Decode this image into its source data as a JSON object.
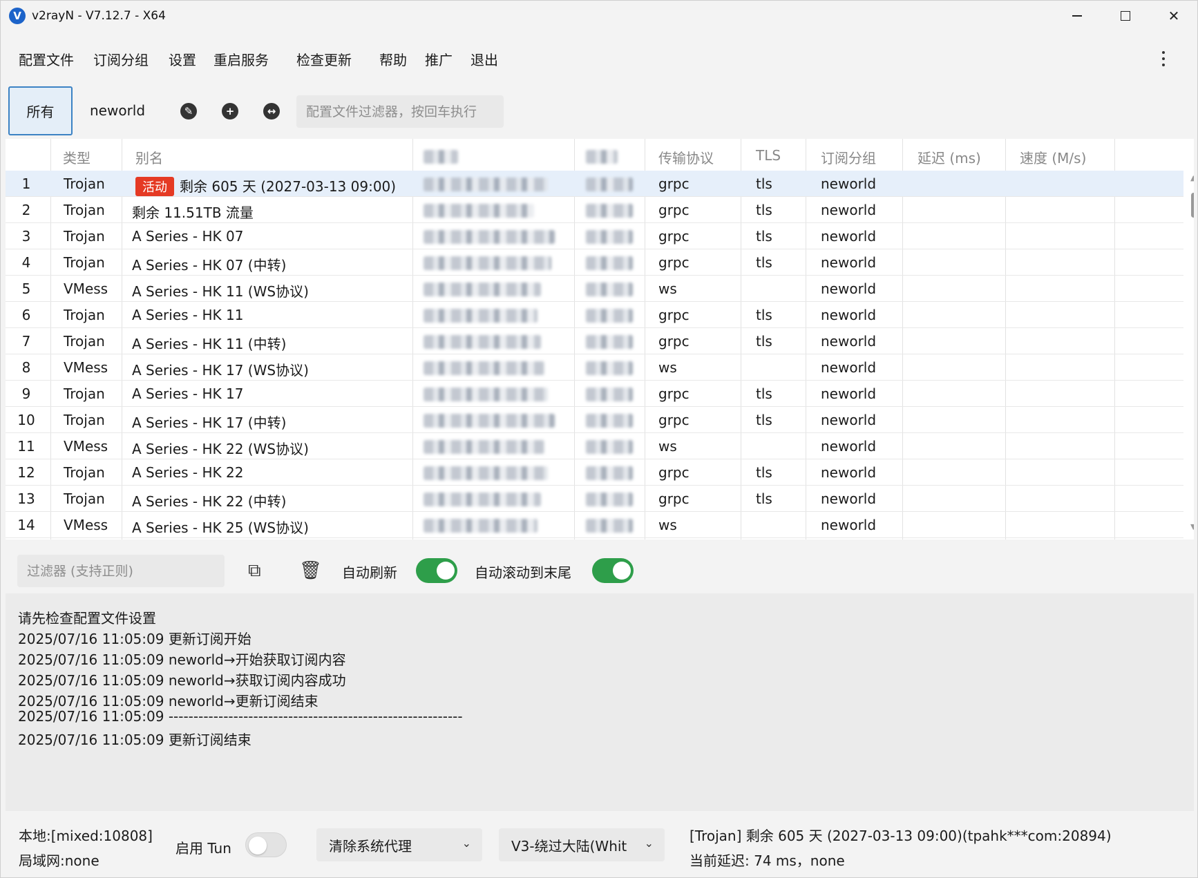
{
  "window": {
    "title": "v2rayN - V7.12.7 - X64",
    "logo": "V"
  },
  "menu": [
    "配置文件",
    "订阅分组",
    "设置",
    "重启服务",
    "检查更新",
    "帮助",
    "推广",
    "退出"
  ],
  "tabs": {
    "all": "所有",
    "neworld": "neworld"
  },
  "toolbar": {
    "filter_placeholder": "配置文件过滤器，按回车执行"
  },
  "table": {
    "headers": [
      "类型",
      "别名",
      "传输协议",
      "TLS",
      "订阅分组",
      "延迟 (ms)",
      "速度 (M/s)"
    ],
    "active_badge": "活动",
    "rows": [
      {
        "n": "1",
        "type": "Trojan",
        "alias": "剩余 605 天 (2027-03-13 09:00)",
        "net": "grpc",
        "tls": "tls",
        "group": "neworld"
      },
      {
        "n": "2",
        "type": "Trojan",
        "alias": "剩余 11.51TB 流量",
        "net": "grpc",
        "tls": "tls",
        "group": "neworld"
      },
      {
        "n": "3",
        "type": "Trojan",
        "alias": "A Series - HK 07",
        "net": "grpc",
        "tls": "tls",
        "group": "neworld"
      },
      {
        "n": "4",
        "type": "Trojan",
        "alias": "A Series - HK 07 (中转)",
        "net": "grpc",
        "tls": "tls",
        "group": "neworld"
      },
      {
        "n": "5",
        "type": "VMess",
        "alias": "A Series - HK 11 (WS协议)",
        "net": "ws",
        "tls": "",
        "group": "neworld"
      },
      {
        "n": "6",
        "type": "Trojan",
        "alias": "A Series - HK 11",
        "net": "grpc",
        "tls": "tls",
        "group": "neworld"
      },
      {
        "n": "7",
        "type": "Trojan",
        "alias": "A Series - HK 11 (中转)",
        "net": "grpc",
        "tls": "tls",
        "group": "neworld"
      },
      {
        "n": "8",
        "type": "VMess",
        "alias": "A Series - HK 17 (WS协议)",
        "net": "ws",
        "tls": "",
        "group": "neworld"
      },
      {
        "n": "9",
        "type": "Trojan",
        "alias": "A Series - HK 17",
        "net": "grpc",
        "tls": "tls",
        "group": "neworld"
      },
      {
        "n": "10",
        "type": "Trojan",
        "alias": "A Series - HK 17 (中转)",
        "net": "grpc",
        "tls": "tls",
        "group": "neworld"
      },
      {
        "n": "11",
        "type": "VMess",
        "alias": "A Series - HK 22 (WS协议)",
        "net": "ws",
        "tls": "",
        "group": "neworld"
      },
      {
        "n": "12",
        "type": "Trojan",
        "alias": "A Series - HK 22",
        "net": "grpc",
        "tls": "tls",
        "group": "neworld"
      },
      {
        "n": "13",
        "type": "Trojan",
        "alias": "A Series - HK 22 (中转)",
        "net": "grpc",
        "tls": "tls",
        "group": "neworld"
      },
      {
        "n": "14",
        "type": "VMess",
        "alias": "A Series - HK 25 (WS协议)",
        "net": "ws",
        "tls": "",
        "group": "neworld"
      }
    ]
  },
  "log_toolbar": {
    "filter_placeholder": "过滤器 (支持正则)",
    "auto_refresh": "自动刷新",
    "auto_scroll": "自动滚动到末尾",
    "auto_refresh_on": true,
    "auto_scroll_on": true
  },
  "log": [
    "请先检查配置文件设置",
    "2025/07/16 11:05:09 更新订阅开始",
    "2025/07/16 11:05:09 neworld→开始获取订阅内容",
    "2025/07/16 11:05:09 neworld→获取订阅内容成功",
    "2025/07/16 11:05:09 neworld→更新订阅结束",
    "2025/07/16 11:05:09 -----------------------------------------------------------",
    "2025/07/16 11:05:09 更新订阅结束"
  ],
  "status": {
    "local": "本地:[mixed:10808]",
    "lan": "局域网:none",
    "tun_label": "启用 Tun",
    "tun_on": false,
    "proxy_mode": "清除系统代理",
    "routing": "V3-绕过大陆(Whit",
    "current_server": "[Trojan] 剩余 605 天 (2027-03-13 09:00)(tpahk***com:20894)",
    "current_delay": "当前延迟: 74 ms，none"
  },
  "colors": {
    "accent": "#3b82c4",
    "toggle_on": "#2e9e4a",
    "badge": "#e53a24"
  }
}
